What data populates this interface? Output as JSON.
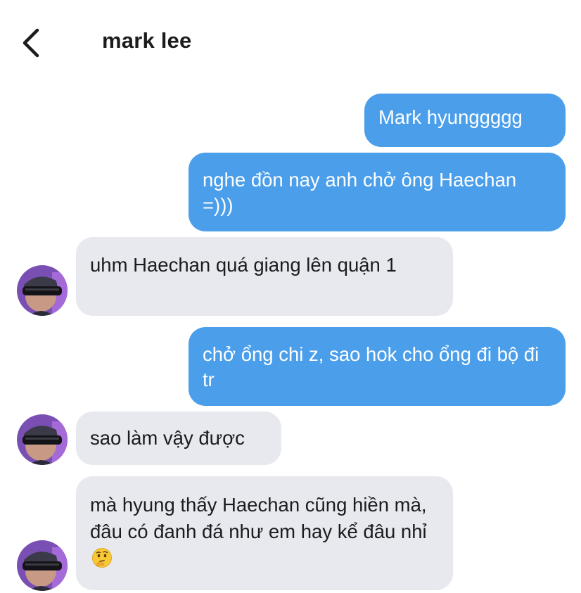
{
  "header": {
    "back_icon": "chevron-left-icon",
    "title": "mark lee"
  },
  "messages": [
    {
      "side": "outgoing",
      "text": "Mark hyunggggg"
    },
    {
      "side": "outgoing",
      "text": "nghe đồn nay anh chở ông Haechan =)))"
    },
    {
      "side": "incoming",
      "text": "uhm Haechan quá giang lên quận 1"
    },
    {
      "side": "outgoing",
      "text": "chở ổng chi z, sao hok cho ổng đi bộ đi tr"
    },
    {
      "side": "incoming",
      "text": "sao làm vậy được"
    },
    {
      "side": "incoming",
      "text": "mà hyung thấy Haechan cũng hiền mà, đâu có đanh đá như em hay kể đâu nhỉ",
      "emoji": "thinking-face-icon"
    }
  ],
  "colors": {
    "outgoing_bubble": "#4a9eea",
    "incoming_bubble": "#e7e9ee",
    "text_dark": "#1c1c1e"
  }
}
